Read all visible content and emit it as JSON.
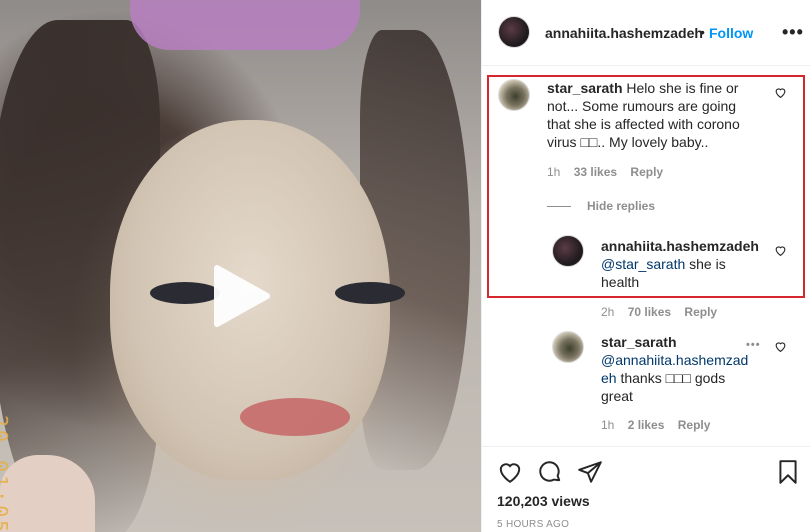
{
  "post": {
    "author": "annahiita.hashemzadeh",
    "separator": "•",
    "follow_label": "Follow",
    "more_label": "•••"
  },
  "media": {
    "type": "video",
    "timestamp_overlay": "20 01:05"
  },
  "comments": [
    {
      "user": "star_sarath",
      "text": "Helo she is fine or not... Some rumours are going that she is affected with corono virus □□.. My lovely baby..",
      "age": "1h",
      "likes": "33 likes",
      "reply_label": "Reply"
    }
  ],
  "hide_replies_label": "Hide replies",
  "replies": [
    {
      "user": "annahiita.hashemzadeh",
      "mention": "@star_sarath",
      "text": " she is health",
      "age": "2h",
      "likes": "70 likes",
      "reply_label": "Reply"
    },
    {
      "user": "star_sarath",
      "mention": "@annahiita.hashemzadeh",
      "text": " thanks □□□ gods great",
      "age": "1h",
      "likes": "2 likes",
      "reply_label": "Reply",
      "more_label": "•••"
    }
  ],
  "stats": {
    "views": "120,203 views",
    "time_ago": "5 HOURS AGO"
  },
  "icons": {
    "like": "heart-icon",
    "comment": "comment-icon",
    "share": "share-icon",
    "save": "bookmark-icon",
    "play": "play-icon"
  },
  "colors": {
    "accent": "#0095f6",
    "highlight": "#d6262e",
    "muted": "#8e8e8e",
    "mention": "#00376b"
  }
}
